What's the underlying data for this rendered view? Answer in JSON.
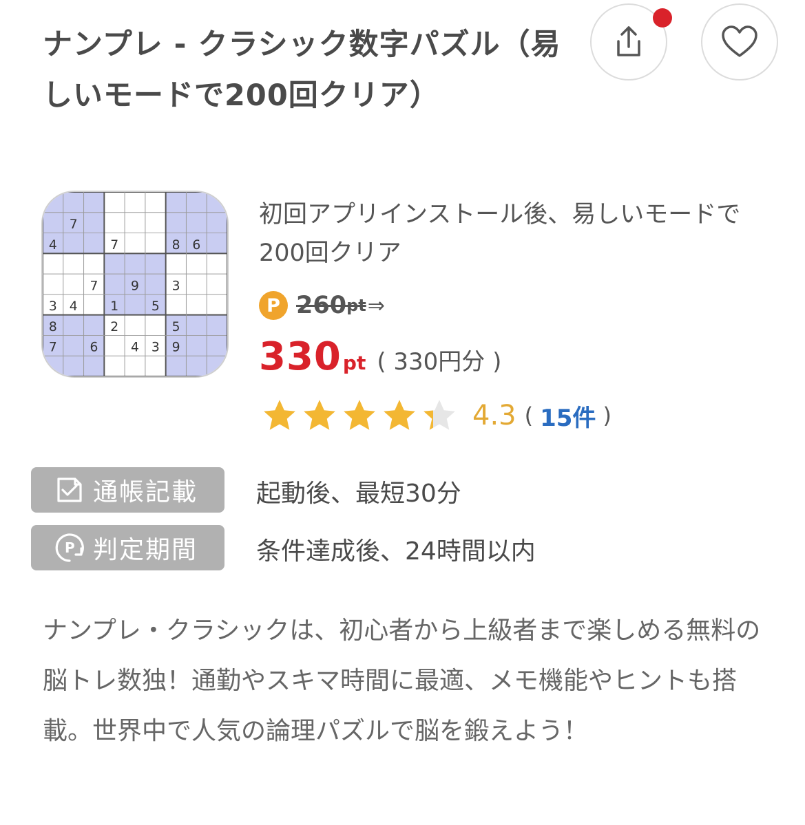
{
  "title": "ナンプレ - クラシック数字パズル（易しいモードで200回クリア）",
  "actions": {
    "share_icon": "share-icon",
    "favorite_icon": "heart-icon",
    "notification": "red-dot"
  },
  "app_icon": {
    "name": "sudoku-app-icon",
    "rows": [
      [
        "",
        "",
        "",
        "",
        "",
        "",
        "",
        "",
        ""
      ],
      [
        "",
        "7",
        "",
        "",
        "",
        "",
        "",
        "",
        ""
      ],
      [
        "4",
        "",
        "",
        "7",
        "",
        "",
        "8",
        "6",
        ""
      ],
      [
        "",
        "",
        "",
        "",
        "",
        "",
        "",
        "",
        ""
      ],
      [
        "",
        "",
        "7",
        "",
        "9",
        "",
        "3",
        "",
        ""
      ],
      [
        "3",
        "4",
        "",
        "1",
        "",
        "5",
        "",
        "",
        ""
      ],
      [
        "8",
        "",
        "",
        "2",
        "",
        "",
        "5",
        "",
        ""
      ],
      [
        "7",
        "",
        "6",
        "",
        "4",
        "3",
        "9",
        "",
        ""
      ],
      [
        "",
        "",
        "",
        "",
        "",
        "",
        "",
        "",
        ""
      ]
    ]
  },
  "condition": "初回アプリインストール後、易しいモードで200回クリア",
  "points": {
    "coin_label": "P",
    "old_value": "260",
    "old_unit": "pt",
    "arrow": "⇒",
    "new_value": "330",
    "new_unit": "pt",
    "yen_note": "( 330円分 )"
  },
  "rating": {
    "stars": 4.3,
    "value": "4.3",
    "open_paren": "(",
    "count": "15件",
    "close_paren": ")",
    "star_color": "#f3b733"
  },
  "badges": [
    {
      "icon": "check-note-icon",
      "label": "通帳記載",
      "value": "起動後、最短30分"
    },
    {
      "icon": "point-clock-icon",
      "label": "判定期間",
      "value": "条件達成後、24時間以内"
    }
  ],
  "description": "ナンプレ・クラシックは、初心者から上級者まで楽しめる無料の脳トレ数独！通勤やスキマ時間に最適、メモ機能やヒントも搭載。世界中で人気の論理パズルで脳を鍛えよう！",
  "colors": {
    "accent_red": "#d9222a",
    "coin": "#f0a42c",
    "link_blue": "#2a6cc0",
    "badge_gray": "#b1b1b1"
  }
}
